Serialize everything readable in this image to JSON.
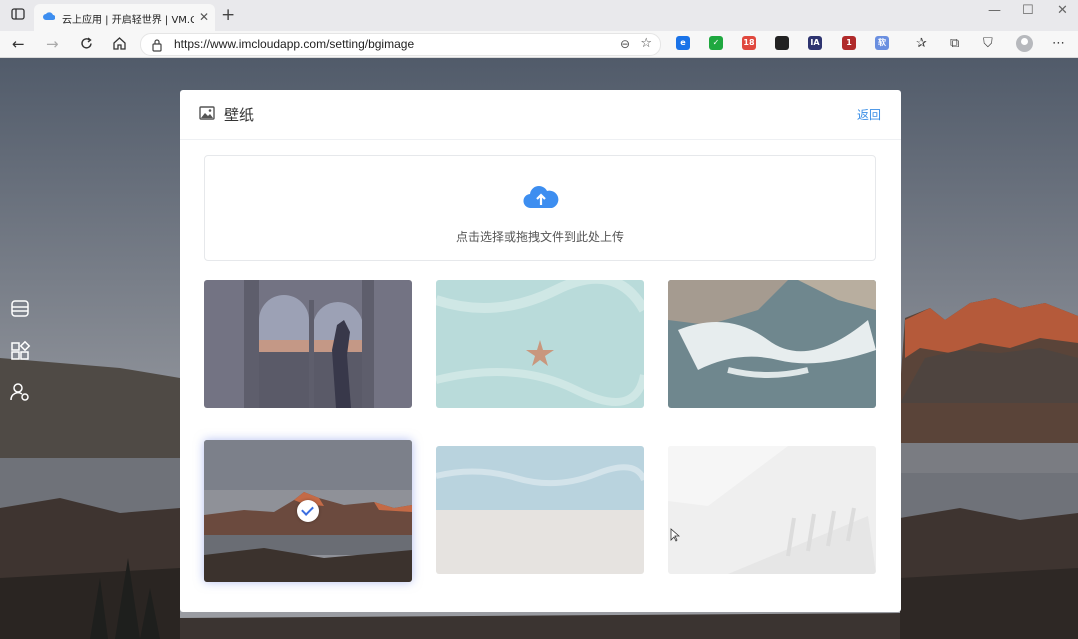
{
  "browser": {
    "tab_title": "云上应用 | 开启轻世界 | VM.COM",
    "tab_close": "✕",
    "new_tab": "+",
    "url": "https://www.imcloudapp.com/setting/bgimage",
    "window_controls": [
      "—",
      "☐",
      "✕"
    ],
    "extensions": [
      {
        "icon": "edge-ext-icon",
        "color": "#1a73e8",
        "label": "e"
      },
      {
        "icon": "check-ext-icon",
        "color": "#1fa83f",
        "label": "✓"
      },
      {
        "icon": "apps-ext-icon",
        "color": "#e0483e",
        "label": "18"
      },
      {
        "icon": "mask-ext-icon",
        "color": "#222222",
        "label": ""
      },
      {
        "icon": "ia-ext-icon",
        "color": "#2e3470",
        "label": "IA"
      },
      {
        "icon": "shield-ext-icon",
        "color": "#b02a2a",
        "label": "1"
      },
      {
        "icon": "translate-ext-icon",
        "color": "#6a8fe0",
        "label": "软"
      }
    ]
  },
  "sidebar": {
    "items": [
      {
        "icon": "storage-icon"
      },
      {
        "icon": "apps-grid-icon"
      },
      {
        "icon": "user-settings-icon"
      }
    ]
  },
  "panel": {
    "title": "壁纸",
    "back_label": "返回",
    "upload_hint": "点击选择或拖拽文件到此处上传"
  },
  "wallpapers": [
    {
      "name": "arch-window-silhouette",
      "selected": false
    },
    {
      "name": "starfish-beach",
      "selected": false
    },
    {
      "name": "ocean-waves-aerial",
      "selected": false
    },
    {
      "name": "mountain-lake-sunset",
      "selected": true
    },
    {
      "name": "sky-sand-minimal",
      "selected": false
    },
    {
      "name": "white-architecture",
      "selected": false
    }
  ],
  "colors": {
    "accent": "#3a8ee6",
    "upload_cloud": "#3d8ef0",
    "selected_glow": "#788ce6"
  }
}
